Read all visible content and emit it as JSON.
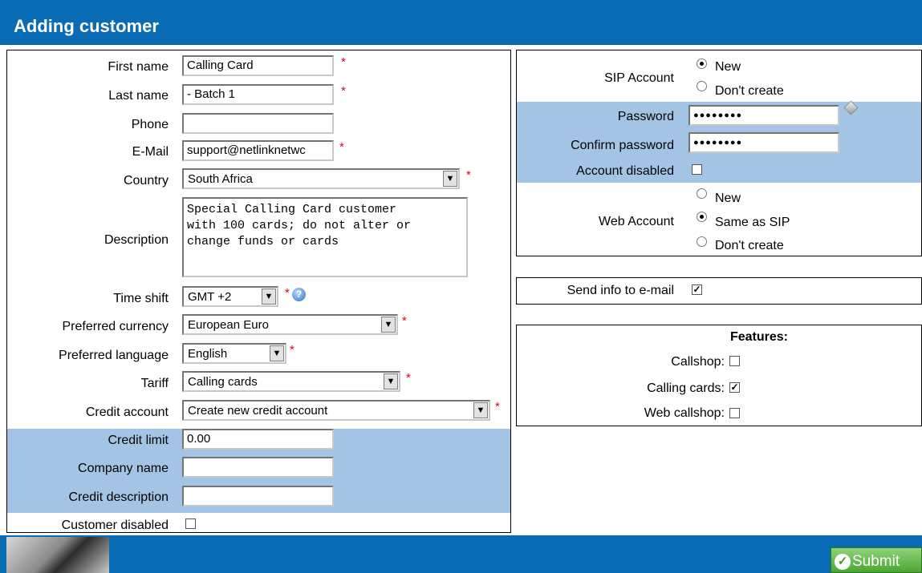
{
  "header": {
    "title": "Adding customer"
  },
  "left": {
    "first_name": {
      "label": "First name",
      "value": "Calling Card"
    },
    "last_name": {
      "label": "Last name",
      "value": "- Batch 1"
    },
    "phone": {
      "label": "Phone",
      "value": ""
    },
    "email": {
      "label": "E-Mail",
      "value": "support@netlinknetwc"
    },
    "country": {
      "label": "Country",
      "value": "South Africa"
    },
    "description": {
      "label": "Description",
      "value": "Special Calling Card customer\nwith 100 cards; do not alter or\nchange funds or cards"
    },
    "time_shift": {
      "label": "Time shift",
      "value": "GMT +2"
    },
    "currency": {
      "label": "Preferred currency",
      "value": "European Euro"
    },
    "language": {
      "label": "Preferred language",
      "value": "English"
    },
    "tariff": {
      "label": "Tariff",
      "value": "Calling cards"
    },
    "credit_account": {
      "label": "Credit account",
      "value": "Create new credit account"
    },
    "credit_limit": {
      "label": "Credit limit",
      "value": "0.00"
    },
    "company_name": {
      "label": "Company name",
      "value": ""
    },
    "credit_description": {
      "label": "Credit description",
      "value": ""
    },
    "customer_disabled": {
      "label": "Customer disabled",
      "checked": false
    },
    "required_mark": "*",
    "help_mark": "?"
  },
  "sip": {
    "label": "SIP Account",
    "options": [
      "New",
      "Don't create"
    ],
    "selected": "New",
    "password": {
      "label": "Password",
      "masked": "●●●●●●●●"
    },
    "confirm_password": {
      "label": "Confirm password",
      "masked": "●●●●●●●●"
    },
    "account_disabled": {
      "label": "Account disabled",
      "checked": false
    }
  },
  "web": {
    "label": "Web Account",
    "options": [
      "New",
      "Same as SIP",
      "Don't create"
    ],
    "selected": "Same as SIP"
  },
  "send_info": {
    "label": "Send info to e-mail",
    "checked": true
  },
  "features": {
    "title": "Features:",
    "items": [
      {
        "label": "Callshop:",
        "checked": false
      },
      {
        "label": "Calling cards:",
        "checked": true
      },
      {
        "label": "Web callshop:",
        "checked": false
      }
    ]
  },
  "footer": {
    "submit_label": "Submit"
  },
  "colors": {
    "header_blue": "#0a6cb4",
    "band_blue": "#a3c4e4",
    "required_red": "#e0001a"
  },
  "icons": {
    "help": "help-icon",
    "generate": "generate-password-icon",
    "submit": "check-circle-icon"
  }
}
